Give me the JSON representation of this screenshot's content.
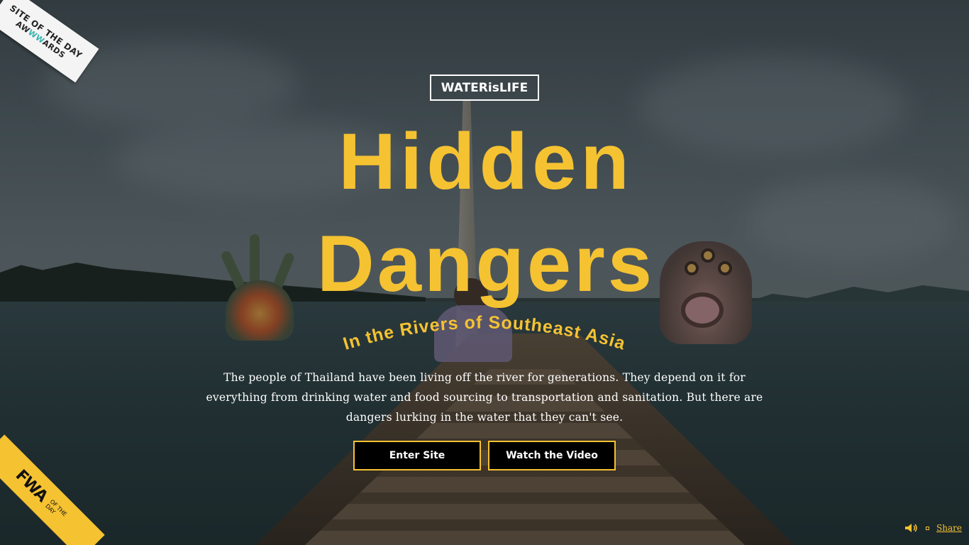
{
  "badges": {
    "awwwards_top": "SITE OF THE DAY",
    "awwwards_bottom_a": "AW",
    "awwwards_bottom_w": "WW",
    "awwwards_bottom_b": "ARDS",
    "fwa_logo": "FWA",
    "fwa_sub": "OF THE DAY"
  },
  "brand": {
    "label": "WATERisLIFE"
  },
  "hero": {
    "title_line1": "Hidden",
    "title_line2": "Dangers",
    "subtitle": "In the Rivers of Southeast Asia",
    "intro": "The people of Thailand have been living off the river for generations. They depend on it for everything from drinking water and food sourcing to transportation and sanitation. But there are dangers lurking in the water that they can't see."
  },
  "actions": {
    "enter_label": "Enter Site",
    "video_label": "Watch the Video"
  },
  "footer": {
    "share_label": "Share",
    "sound_icon": "speaker-icon"
  },
  "colors": {
    "accent": "#f5c232",
    "button_bg": "#000000",
    "text": "#ffffff"
  }
}
